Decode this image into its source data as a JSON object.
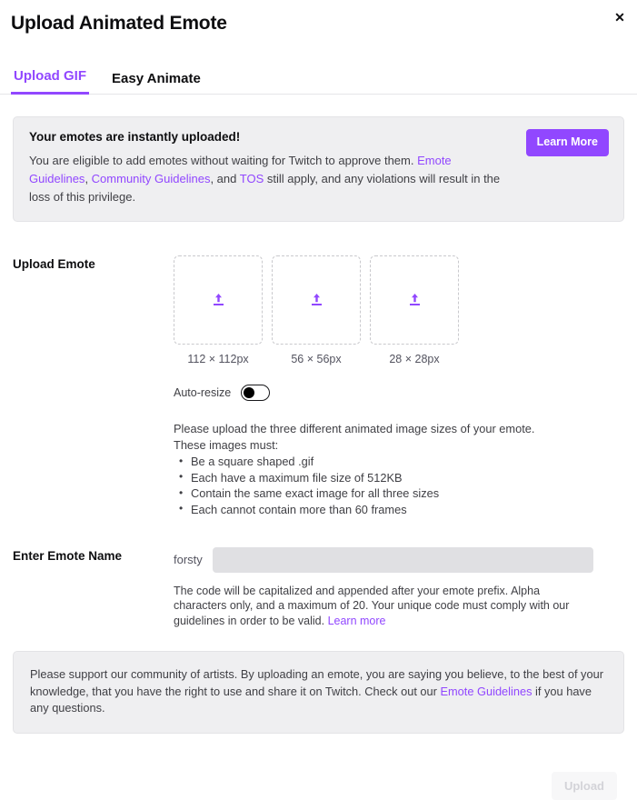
{
  "modal": {
    "title": "Upload Animated Emote",
    "close_label": "✕"
  },
  "tabs": [
    {
      "label": "Upload GIF",
      "active": true
    },
    {
      "label": "Easy Animate",
      "active": false
    }
  ],
  "banner": {
    "title": "Your emotes are instantly uploaded!",
    "body_part1": "You are eligible to add emotes without waiting for Twitch to approve them. ",
    "link_emote_guidelines": "Emote Guidelines",
    "body_part2": ", ",
    "link_community_guidelines": "Community Guidelines",
    "body_part3": ", and ",
    "link_tos": "TOS",
    "body_part4": " still apply, and any violations will result in the loss of this privilege.",
    "learn_more_label": "Learn More"
  },
  "upload_emote": {
    "section_label": "Upload Emote",
    "dropzones": [
      {
        "size_label": "112 × 112px",
        "icon": "upload-arrow-icon"
      },
      {
        "size_label": "56 × 56px",
        "icon": "upload-arrow-icon"
      },
      {
        "size_label": "28 × 28px",
        "icon": "upload-arrow-icon"
      }
    ],
    "auto_resize_label": "Auto-resize",
    "auto_resize_on": false,
    "instructions_line1": "Please upload the three different animated image sizes of your emote.",
    "instructions_line2": "These images must:",
    "requirements": [
      "Be a square shaped .gif",
      "Each have a maximum file size of 512KB",
      "Contain the same exact image for all three sizes",
      "Each cannot contain more than 60 frames"
    ]
  },
  "emote_name": {
    "section_label": "Enter Emote Name",
    "prefix": "forsty",
    "input_value": "",
    "input_placeholder": "",
    "help_text": "The code will be capitalized and appended after your emote prefix. Alpha characters only, and a maximum of 20. Your unique code must comply with our guidelines in order to be valid. ",
    "help_link": "Learn more"
  },
  "disclaimer": {
    "part1": "Please support our community of artists. By uploading an emote, you are saying you believe, to the best of your knowledge, that you have the right to use and share it on Twitch. Check out our ",
    "link": "Emote Guidelines",
    "part2": " if you have any questions."
  },
  "footer": {
    "upload_label": "Upload"
  },
  "colors": {
    "accent": "#9147ff",
    "banner_bg": "#efeff1",
    "input_bg": "#e0e0e3",
    "text": "#0e0e10",
    "muted_text": "#3f3f44"
  }
}
